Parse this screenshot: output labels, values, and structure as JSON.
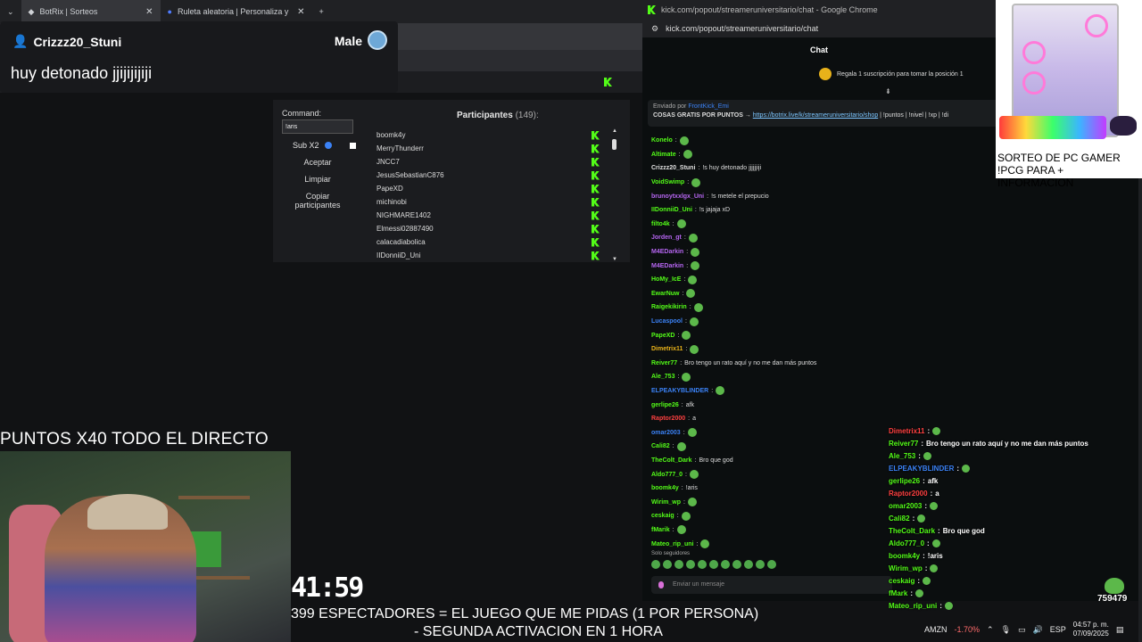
{
  "browser": {
    "tabs": [
      {
        "label": "BotRix | Sorteos",
        "active": true
      },
      {
        "label": "Ruleta aleatoria | Personaliza y",
        "active": false
      }
    ],
    "new_tab": "+"
  },
  "alert": {
    "username": "Crizzz20_Stuni",
    "gender": "Male",
    "message": "huy detonado jjijijijiji"
  },
  "sorteo": {
    "command_label": "Command:",
    "command_value": "!aris",
    "sub_label": "Sub X2",
    "accept": "Aceptar",
    "clear": "Limpiar",
    "copy": "Copiar participantes",
    "participants_title": "Participantes",
    "participants_count": "(149):",
    "participants": [
      "boomk4y",
      "MerryThunderr",
      "JNCC7",
      "JesusSebastianC876",
      "PapeXD",
      "michinobi",
      "NIGHMARE1402",
      "Elmessi02887490",
      "calacadiabolica",
      "IIDonniiD_Uni"
    ]
  },
  "overlay": {
    "puntos": "PUNTOS X40 TODO EL DIRECTO",
    "timer": "41:59",
    "espectadores": "399 ESPECTADORES = EL JUEGO QUE ME PIDAS (1 POR PERSONA)",
    "activacion": "- SEGUNDA ACTIVACION EN 1 HORA",
    "viewer_count": "759479"
  },
  "popout": {
    "window_title": "kick.com/popout/streameruniversitario/chat - Google Chrome",
    "url": "kick.com/popout/streameruniversitario/chat",
    "chat_header": "Chat",
    "gift_text": "Regala 1 suscripción para tomar la posición 1",
    "pinned_sender_prefix": "Enviado por",
    "pinned_sender": "FrontKick_Emi",
    "pinned_text": "COSAS GRATIS POR PUNTOS",
    "pinned_link": "https://botrix.live/k/streameruniversitario/shop",
    "pinned_tail": "| !puntos | !nivel | !xp | !di",
    "followers_only": "Solo seguidores",
    "send_placeholder": "Enviar un mensaje",
    "messages": [
      {
        "user": "Konelo",
        "color": "#53fc18",
        "text": ""
      },
      {
        "user": "Altimate",
        "color": "#53fc18",
        "text": ""
      },
      {
        "user": "Crizzz20_Stuni",
        "color": "#e0e0e0",
        "text": "!s huy detonado jjjjjjiji"
      },
      {
        "user": "VoidSwimp",
        "color": "#53fc18",
        "text": ""
      },
      {
        "user": "brunoytxxlgx_Uni",
        "color": "#b565f0",
        "text": "!s metele el prepucio"
      },
      {
        "user": "IIDonniiD_Uni",
        "color": "#53fc18",
        "text": "!s jajaja xD"
      },
      {
        "user": "filto4k",
        "color": "#53fc18",
        "text": ""
      },
      {
        "user": "Jorden_gt",
        "color": "#b565f0",
        "text": ""
      },
      {
        "user": "M4EDarkin",
        "color": "#b565f0",
        "text": ""
      },
      {
        "user": "M4EDarkin",
        "color": "#b565f0",
        "text": ""
      },
      {
        "user": "HoMy_IcE",
        "color": "#53fc18",
        "text": ""
      },
      {
        "user": "EwarNuw",
        "color": "#53fc18",
        "text": ""
      },
      {
        "user": "Raigekikirin",
        "color": "#53fc18",
        "text": ""
      },
      {
        "user": "Lucaspool",
        "color": "#3b82f6",
        "text": ""
      },
      {
        "user": "PapeXD",
        "color": "#53fc18",
        "text": ""
      },
      {
        "user": "Dimetrix11",
        "color": "#e8b21a",
        "text": ""
      },
      {
        "user": "Reiver77",
        "color": "#53fc18",
        "text": "Bro tengo un rato aquí y no me dan más puntos"
      },
      {
        "user": "Ale_753",
        "color": "#53fc18",
        "text": ""
      },
      {
        "user": "ELPEAKYBLINDER",
        "color": "#3b82f6",
        "text": ""
      },
      {
        "user": "gerlipe26",
        "color": "#53fc18",
        "text": "afk"
      },
      {
        "user": "Raptor2000",
        "color": "#ff4040",
        "text": "a"
      },
      {
        "user": "omar2003",
        "color": "#3b82f6",
        "text": ""
      },
      {
        "user": "Cali82",
        "color": "#53fc18",
        "text": ""
      },
      {
        "user": "TheColt_Dark",
        "color": "#53fc18",
        "text": "Bro que god"
      },
      {
        "user": "Aldo777_0",
        "color": "#53fc18",
        "text": ""
      },
      {
        "user": "boomk4y",
        "color": "#53fc18",
        "text": "!aris"
      },
      {
        "user": "Wirim_wp",
        "color": "#53fc18",
        "text": ""
      },
      {
        "user": "ceskaig",
        "color": "#53fc18",
        "text": ""
      },
      {
        "user": "fMarik",
        "color": "#53fc18",
        "text": ""
      },
      {
        "user": "Mateo_rip_uni",
        "color": "#53fc18",
        "text": ""
      }
    ]
  },
  "overlay_chat": [
    {
      "user": "Dimetrix11",
      "color": "#ff4040",
      "text": ""
    },
    {
      "user": "Reiver77",
      "color": "#53fc18",
      "text": "Bro tengo un rato aquí y no me dan más puntos"
    },
    {
      "user": "Ale_753",
      "color": "#53fc18",
      "text": ""
    },
    {
      "user": "ELPEAKYBLINDER",
      "color": "#3b82f6",
      "text": ""
    },
    {
      "user": "gerlipe26",
      "color": "#53fc18",
      "text": "afk"
    },
    {
      "user": "Raptor2000",
      "color": "#ff4040",
      "text": "a"
    },
    {
      "user": "omar2003",
      "color": "#53fc18",
      "text": ""
    },
    {
      "user": "Cali82",
      "color": "#53fc18",
      "text": ""
    },
    {
      "user": "TheColt_Dark",
      "color": "#53fc18",
      "text": "Bro que god"
    },
    {
      "user": "Aldo777_0",
      "color": "#53fc18",
      "text": ""
    },
    {
      "user": "boomk4y",
      "color": "#53fc18",
      "text": "!aris"
    },
    {
      "user": "Wirim_wp",
      "color": "#53fc18",
      "text": ""
    },
    {
      "user": "ceskaig",
      "color": "#53fc18",
      "text": ""
    },
    {
      "user": "fMark",
      "color": "#53fc18",
      "text": ""
    },
    {
      "user": "Mateo_rip_uni",
      "color": "#53fc18",
      "text": ""
    }
  ],
  "promo": {
    "line1": "SORTEO DE PC GAMER",
    "line2": "!PCG PARA + INFORMACION"
  },
  "tray": {
    "ticker": "AMZN",
    "change": "-1.70%",
    "lang": "ESP",
    "time": "04:57 p. m.",
    "date": "07/09/2025"
  }
}
